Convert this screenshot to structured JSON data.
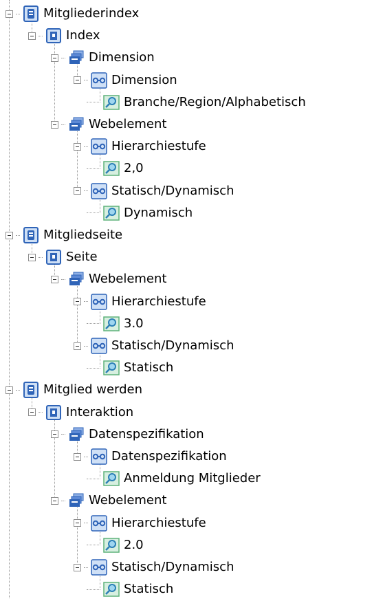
{
  "icons": {
    "group": "cylinder-db-icon",
    "node": "container-icon",
    "folder": "stack-icon",
    "attribute": "link-chain-icon",
    "value": "magnifier-value-icon"
  },
  "colors": {
    "icon_blue": "#2f64b8",
    "icon_light": "#cfe0f6",
    "value_green": "#5fb27a",
    "value_bg": "#d7efe0",
    "dotted_line": "#9a9a9a"
  },
  "tree": [
    {
      "label": "Mitgliederindex",
      "level": 0,
      "type": "group",
      "expanded": true
    },
    {
      "label": "Index",
      "level": 1,
      "type": "node",
      "expanded": true
    },
    {
      "label": "Dimension",
      "level": 2,
      "type": "folder",
      "expanded": true
    },
    {
      "label": "Dimension",
      "level": 3,
      "type": "attribute",
      "expanded": true
    },
    {
      "label": "Branche/Region/Alphabetisch",
      "level": 4,
      "type": "value"
    },
    {
      "label": "Webelement",
      "level": 2,
      "type": "folder",
      "expanded": true
    },
    {
      "label": "Hierarchiestufe",
      "level": 3,
      "type": "attribute",
      "expanded": true
    },
    {
      "label": "2,0",
      "level": 4,
      "type": "value"
    },
    {
      "label": "Statisch/Dynamisch",
      "level": 3,
      "type": "attribute",
      "expanded": true
    },
    {
      "label": "Dynamisch",
      "level": 4,
      "type": "value"
    },
    {
      "label": "Mitgliedseite",
      "level": 0,
      "type": "group",
      "expanded": true
    },
    {
      "label": "Seite",
      "level": 1,
      "type": "node",
      "expanded": true
    },
    {
      "label": "Webelement",
      "level": 2,
      "type": "folder",
      "expanded": true
    },
    {
      "label": "Hierarchiestufe",
      "level": 3,
      "type": "attribute",
      "expanded": true
    },
    {
      "label": "3.0",
      "level": 4,
      "type": "value"
    },
    {
      "label": "Statisch/Dynamisch",
      "level": 3,
      "type": "attribute",
      "expanded": true
    },
    {
      "label": "Statisch",
      "level": 4,
      "type": "value"
    },
    {
      "label": "Mitglied werden",
      "level": 0,
      "type": "group",
      "expanded": true
    },
    {
      "label": "Interaktion",
      "level": 1,
      "type": "node",
      "expanded": true
    },
    {
      "label": "Datenspezifikation",
      "level": 2,
      "type": "folder",
      "expanded": true
    },
    {
      "label": "Datenspezifikation",
      "level": 3,
      "type": "attribute",
      "expanded": true
    },
    {
      "label": "Anmeldung Mitglieder",
      "level": 4,
      "type": "value"
    },
    {
      "label": "Webelement",
      "level": 2,
      "type": "folder",
      "expanded": true
    },
    {
      "label": "Hierarchiestufe",
      "level": 3,
      "type": "attribute",
      "expanded": true
    },
    {
      "label": "2.0",
      "level": 4,
      "type": "value"
    },
    {
      "label": "Statisch/Dynamisch",
      "level": 3,
      "type": "attribute",
      "expanded": true
    },
    {
      "label": "Statisch",
      "level": 4,
      "type": "value"
    }
  ]
}
